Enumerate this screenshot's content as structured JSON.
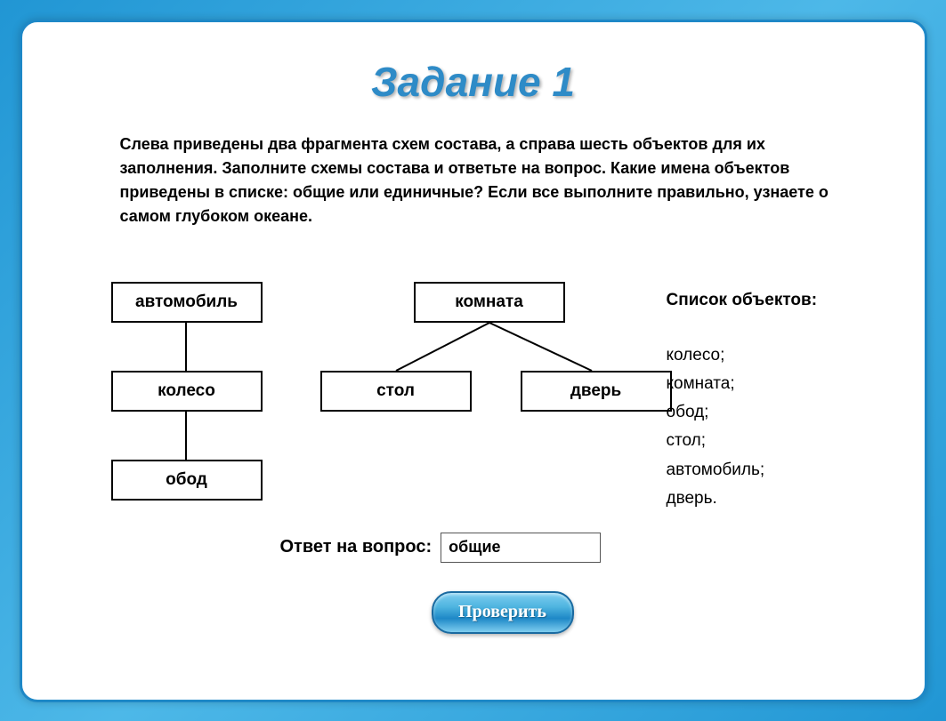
{
  "title": "Задание 1",
  "instructions": "Слева приведены два фрагмента схем состава, а справа шесть объектов для их заполнения. Заполните схемы состава и ответьте на вопрос. Какие имена объектов приведены в списке: общие или единичные? Если все выполните правильно, узнаете о самом глубоком океане.",
  "diagram": {
    "auto": "автомобиль",
    "wheel": "колесо",
    "rim": "обод",
    "room": "комната",
    "table": "стол",
    "door": "дверь"
  },
  "objects": {
    "title": "Список объектов:",
    "items": [
      "колесо;",
      "комната;",
      "обод;",
      "стол;",
      "автомобиль;",
      "дверь."
    ]
  },
  "answer": {
    "label": "Ответ на вопрос:",
    "value": "общие"
  },
  "buttons": {
    "check": "Проверить"
  }
}
